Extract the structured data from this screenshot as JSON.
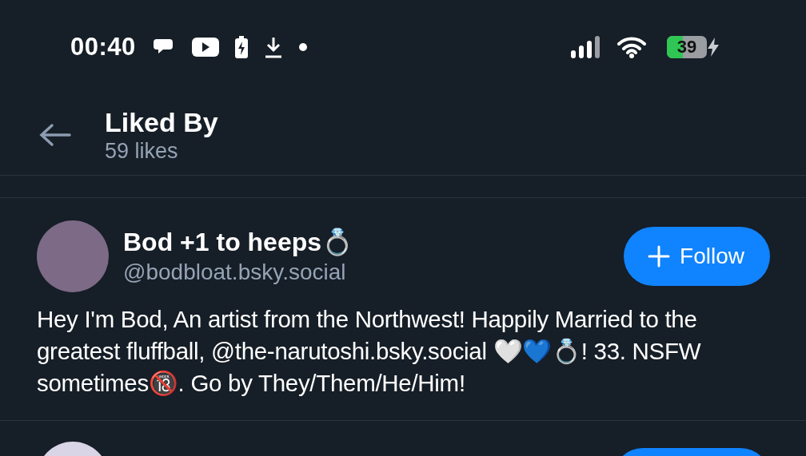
{
  "status_bar": {
    "time": "00:40",
    "battery": "39"
  },
  "header": {
    "title": "Liked By",
    "subtitle": "59 likes"
  },
  "users": [
    {
      "name": "Bod +1 to heeps💍",
      "handle": "@bodbloat.bsky.social",
      "button": "Follow",
      "bio": "Hey I'm Bod, An artist from the Northwest! Happily Married to the greatest fluffball, @the-narutoshi.bsky.social  🤍💙💍! 33. NSFW sometimes🔞. Go by They/Them/He/Him!"
    }
  ]
}
